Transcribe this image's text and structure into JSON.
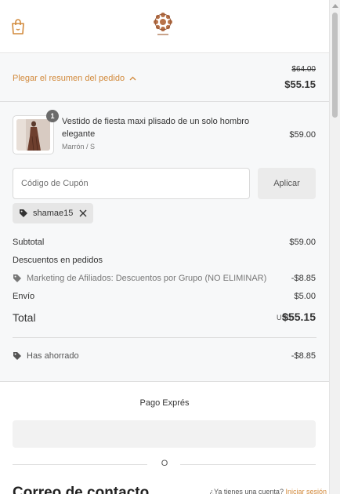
{
  "colors": {
    "accent": "#d28a3c",
    "summary_bg": "#f7f8f9",
    "border": "#dedede",
    "text": "#333333"
  },
  "header": {
    "cart_icon": "shopping-bag-icon",
    "logo_icon": "mandala-logo-icon"
  },
  "summary": {
    "toggle_label": "Plegar el resumen del pedido",
    "toggle_icon": "chevron-up-icon",
    "original_total": "$64.00",
    "current_total": "$55.15"
  },
  "product": {
    "quantity": "1",
    "name": "Vestido de fiesta maxi plisado de un solo hombro elegante",
    "variant": "Marrón / S",
    "price": "$59.00"
  },
  "coupon": {
    "placeholder": "Código de Cupón",
    "value": "",
    "apply_label": "Aplicar",
    "applied_code": "shamae15",
    "tag_icon": "tag-icon",
    "remove_icon": "close-icon"
  },
  "totals": {
    "subtotal_label": "Subtotal",
    "subtotal_value": "$59.00",
    "order_discounts_label": "Descuentos en pedidos",
    "discount_name": "Marketing de Afiliados: Descuentos por Grupo (NO ELIMINAR)",
    "discount_value": "-$8.85",
    "shipping_label": "Envío",
    "shipping_value": "$5.00",
    "total_label": "Total",
    "currency": "USD",
    "total_value": "$55.15",
    "saved_label": "Has ahorrado",
    "saved_value": "-$8.85"
  },
  "express": {
    "title": "Pago Exprés",
    "or_label": "O"
  },
  "contact": {
    "heading": "Correo de contacto",
    "account_prompt": "¿Ya tienes una cuenta?",
    "login_link": "Iniciar sesión"
  }
}
